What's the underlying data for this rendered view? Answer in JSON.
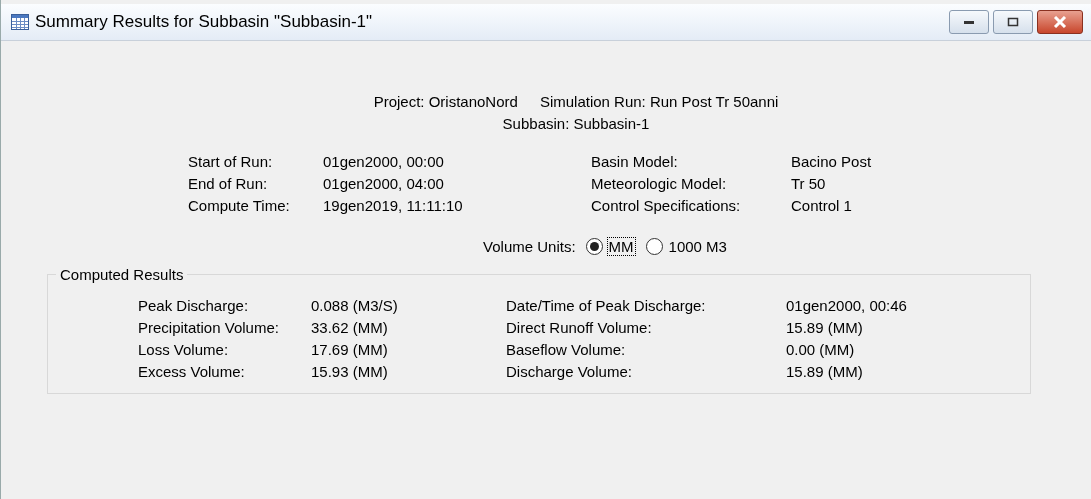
{
  "window": {
    "title": "Summary Results for Subbasin \"Subbasin-1\""
  },
  "header": {
    "project": "Project: OristanoNord",
    "simulation_run": "Simulation Run: Run Post Tr 50anni",
    "subbasin": "Subbasin: Subbasin-1"
  },
  "run_info_left": [
    {
      "label": "Start of Run:",
      "value": "01gen2000, 00:00"
    },
    {
      "label": "End of Run:",
      "value": "01gen2000, 04:00"
    },
    {
      "label": "Compute Time:",
      "value": "19gen2019, 11:11:10"
    }
  ],
  "run_info_right": [
    {
      "label": "Basin Model:",
      "value": "Bacino Post"
    },
    {
      "label": "Meteorologic Model:",
      "value": "Tr 50"
    },
    {
      "label": "Control Specifications:",
      "value": "Control 1"
    }
  ],
  "volume_units": {
    "label": "Volume Units:",
    "options": [
      {
        "label": "MM",
        "selected": true
      },
      {
        "label": "1000 M3",
        "selected": false
      }
    ]
  },
  "computed_results": {
    "title": "Computed Results",
    "left": [
      {
        "label": "Peak Discharge:",
        "value": "0.088 (M3/S)"
      },
      {
        "label": "Precipitation Volume:",
        "value": "33.62 (MM)"
      },
      {
        "label": "Loss Volume:",
        "value": "17.69 (MM)"
      },
      {
        "label": "Excess Volume:",
        "value": "15.93 (MM)"
      }
    ],
    "right": [
      {
        "label": "Date/Time of Peak Discharge:",
        "value": "01gen2000, 00:46"
      },
      {
        "label": "Direct Runoff Volume:",
        "value": "15.89 (MM)"
      },
      {
        "label": "Baseflow Volume:",
        "value": "0.00 (MM)"
      },
      {
        "label": "Discharge Volume:",
        "value": "15.89 (MM)"
      }
    ]
  }
}
